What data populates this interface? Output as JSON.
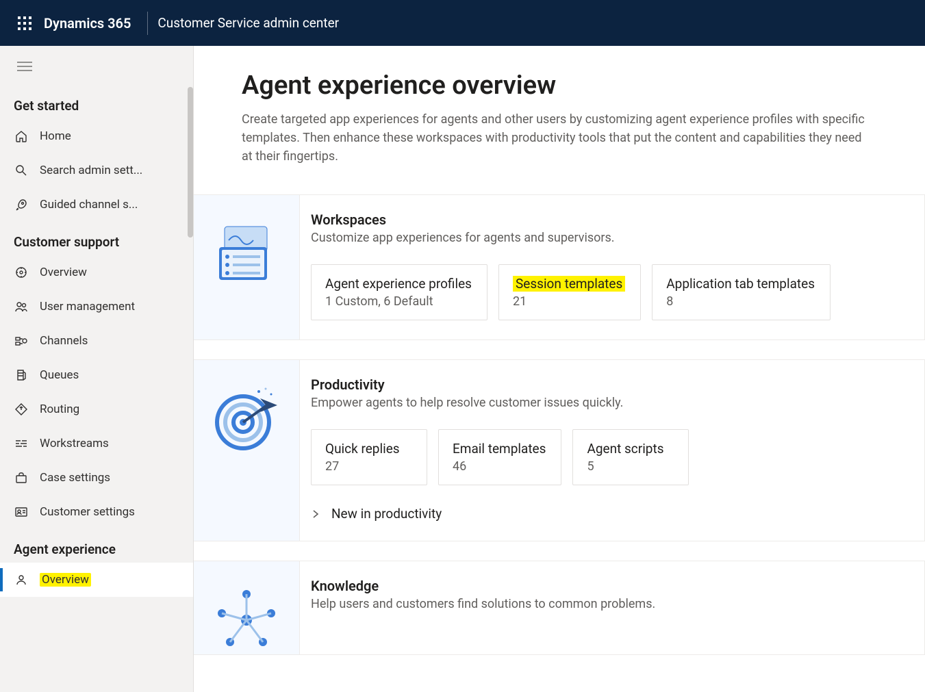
{
  "header": {
    "brand": "Dynamics 365",
    "app_title": "Customer Service admin center"
  },
  "sidebar": {
    "sections": {
      "get_started": {
        "label": "Get started",
        "items": [
          {
            "label": "Home"
          },
          {
            "label": "Search admin sett..."
          },
          {
            "label": "Guided channel s..."
          }
        ]
      },
      "customer_support": {
        "label": "Customer support",
        "items": [
          {
            "label": "Overview"
          },
          {
            "label": "User management"
          },
          {
            "label": "Channels"
          },
          {
            "label": "Queues"
          },
          {
            "label": "Routing"
          },
          {
            "label": "Workstreams"
          },
          {
            "label": "Case settings"
          },
          {
            "label": "Customer settings"
          }
        ]
      },
      "agent_experience": {
        "label": "Agent experience",
        "items": [
          {
            "label": "Overview"
          }
        ]
      }
    }
  },
  "main": {
    "title": "Agent experience overview",
    "description": "Create targeted app experiences for agents and other users by customizing agent experience profiles with specific templates. Then enhance these workspaces with productivity tools that put the content and capabilities they need at their fingertips.",
    "cards": {
      "workspaces": {
        "heading": "Workspaces",
        "sub": "Customize app experiences for agents and supervisors.",
        "tiles": [
          {
            "title": "Agent experience profiles",
            "meta": "1 Custom, 6 Default"
          },
          {
            "title": "Session templates",
            "meta": "21"
          },
          {
            "title": "Application tab templates",
            "meta": "8"
          }
        ]
      },
      "productivity": {
        "heading": "Productivity",
        "sub": "Empower agents to help resolve customer issues quickly.",
        "tiles": [
          {
            "title": "Quick replies",
            "meta": "27"
          },
          {
            "title": "Email templates",
            "meta": "46"
          },
          {
            "title": "Agent scripts",
            "meta": "5"
          }
        ],
        "link": "New in productivity"
      },
      "knowledge": {
        "heading": "Knowledge",
        "sub": "Help users and customers find solutions to common problems."
      }
    }
  }
}
